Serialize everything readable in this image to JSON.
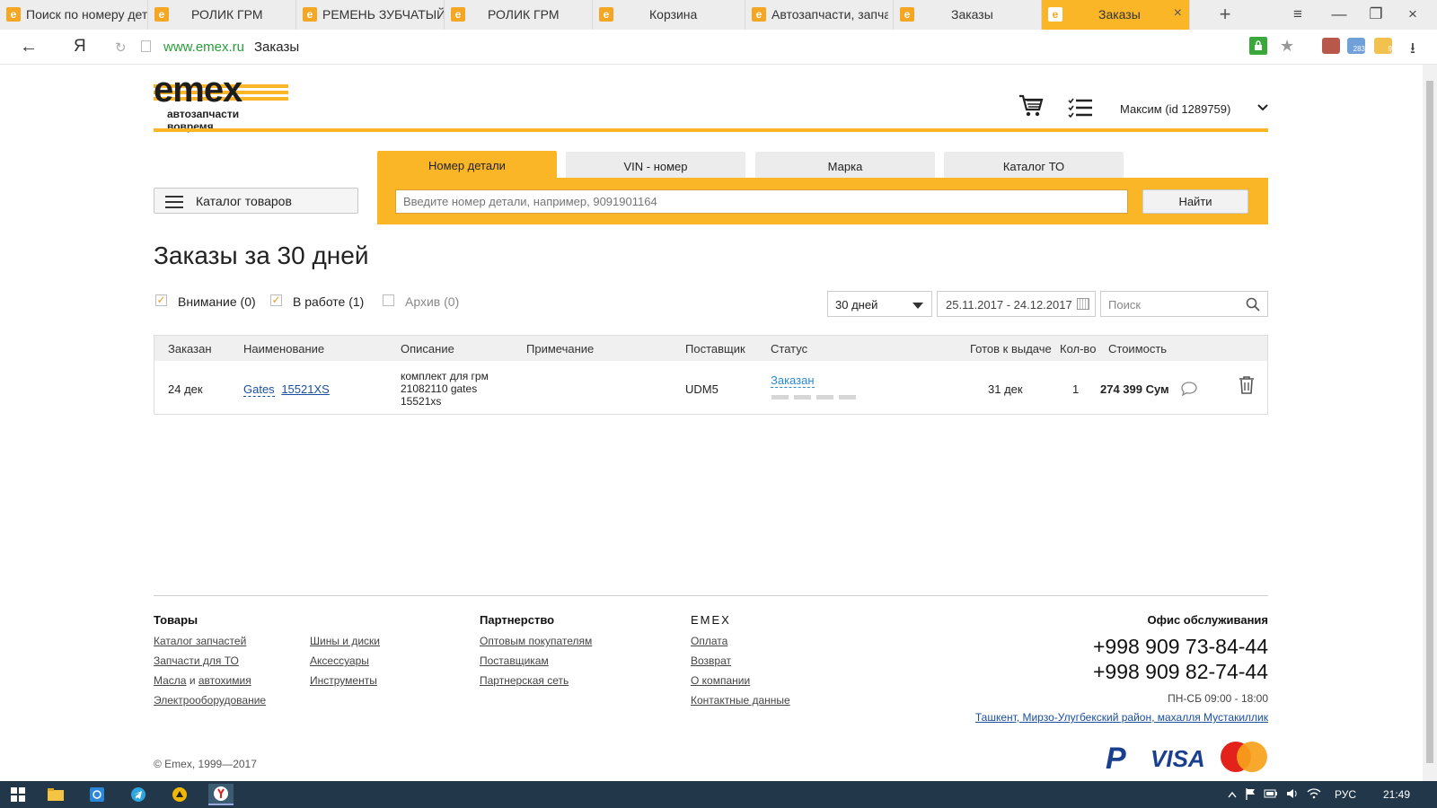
{
  "browser": {
    "tabs": [
      {
        "title": "Поиск по номеру детали",
        "active": false
      },
      {
        "title": "РОЛИК ГРМ",
        "active": false
      },
      {
        "title": "РЕМЕНЬ ЗУБЧАТЫЙ",
        "active": false
      },
      {
        "title": "РОЛИК ГРМ",
        "active": false
      },
      {
        "title": "Корзина",
        "active": false
      },
      {
        "title": "Автозапчасти, запчасти",
        "active": false
      },
      {
        "title": "Заказы",
        "active": false
      },
      {
        "title": "Заказы",
        "active": true
      }
    ],
    "favicon_letter": "e",
    "new_tab_symbol": "+",
    "close_tab_symbol": "×",
    "back_symbol": "←",
    "yandex_button": "Я",
    "reload_symbol": "↻",
    "url_host": "www.emex.ru",
    "url_title": "Заказы",
    "menu_symbol": "≡",
    "restore_symbol": "❐",
    "minimize_symbol": "—",
    "bookmark_symbol": "★",
    "download_symbol": "⭳",
    "extension_badges": [
      "283",
      "9"
    ]
  },
  "site": {
    "logo_text": "emex",
    "logo_tagline": "автозапчасти вовремя",
    "user_label": "Максим  (id 1289759)",
    "user_chevron": "⌄",
    "brand_color": "#fbb627"
  },
  "search": {
    "catalog_button": "Каталог товаров",
    "tabs": [
      "Номер детали",
      "VIN - номер",
      "Марка",
      "Каталог ТО"
    ],
    "active_tab_index": 0,
    "placeholder": "Введите номер детали, например, 9091901164",
    "find_button": "Найти"
  },
  "orders": {
    "title": "Заказы за 30 дней",
    "filters": [
      {
        "label": "Внимание (0)",
        "checked": true
      },
      {
        "label": "В работе (1)",
        "checked": true
      },
      {
        "label": "Архив (0)",
        "checked": false
      }
    ],
    "check_mark": "✓",
    "period": "30 дней",
    "date_range": "25.11.2017 - 24.12.2017",
    "search_placeholder": "Поиск",
    "columns": {
      "ordered": "Заказан",
      "name": "Наименование",
      "description": "Описание",
      "note": "Примечание",
      "supplier": "Поставщик",
      "status": "Статус",
      "ready": "Готов к выдаче",
      "qty": "Кол-во",
      "cost": "Стоимость"
    },
    "rows": [
      {
        "ordered": "24 дек",
        "brand": "Gates",
        "code": "15521XS",
        "description": [
          "комплект для грм",
          "21082110 gates",
          "15521xs"
        ],
        "note": "",
        "supplier": "UDM5",
        "status": "Заказан",
        "status_progress_steps": 4,
        "ready": "31 дек",
        "qty": "1",
        "cost": "274 399 Сум"
      }
    ]
  },
  "footer": {
    "goods_heading": "Товары",
    "goods_col1": [
      "Каталог запчастей",
      "Запчасти для ТО"
    ],
    "oils_label": "Масла",
    "oils_and": "и",
    "chemistry_label": "автохимия",
    "electro_label": "Электрооборудование",
    "goods_col2": [
      "Шины и диски",
      "Аксессуары",
      "Инструменты"
    ],
    "partner_heading": "Партнерство",
    "partner_links": [
      "Оптовым покупателям",
      "Поставщикам",
      "Партнерская сеть"
    ],
    "emex_heading": "EMEX",
    "emex_links": [
      "Оплата",
      "Возврат",
      "О компании",
      "Контактные данные"
    ],
    "office_heading": "Офис обслуживания",
    "phones": [
      "+998 909 73-84-44",
      "+998 909 82-74-44"
    ],
    "hours": "ПН-СБ 09:00 - 18:00",
    "address": "Ташкент, Мирзо-Улугбекский район, махалля Мустакиллик",
    "copyright": "© Emex, 1999—2017",
    "payment_logos": [
      "PayPal",
      "VISA",
      "Mastercard"
    ],
    "paypal_mark": "P",
    "visa_mark": "VISA"
  },
  "taskbar": {
    "keyboard_layout": "РУС",
    "time": "21:49"
  }
}
